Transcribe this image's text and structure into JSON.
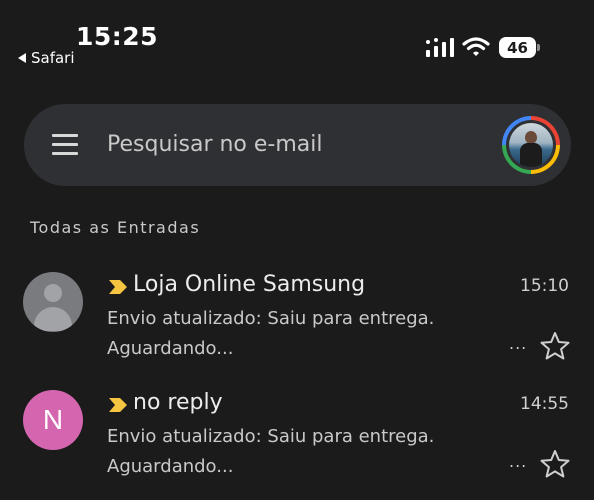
{
  "status_bar": {
    "time": "15:25",
    "back_app": "Safari",
    "battery": "46"
  },
  "search": {
    "placeholder": "Pesquisar no e-mail"
  },
  "section": {
    "title": "Todas as Entradas"
  },
  "emails": [
    {
      "sender": "Loja Online Samsung",
      "time": "15:10",
      "snippet_line1": "Envio atualizado: Saiu para entrega.",
      "snippet_line2": "Aguardando...",
      "more": "...",
      "avatar_letter": ""
    },
    {
      "sender": "no reply",
      "time": "14:55",
      "snippet_line1": "Envio atualizado: Saiu para entrega.",
      "snippet_line2": "Aguardando...",
      "more": "...",
      "avatar_letter": "N"
    }
  ],
  "colors": {
    "background": "#1b1b1c",
    "search_bar": "#2f3033",
    "importance_marker": "#f5c542",
    "avatar_n": "#d466b0"
  },
  "icons": [
    "menu-icon",
    "account-avatar",
    "importance-marker-icon",
    "star-icon",
    "signal-icon",
    "wifi-icon",
    "battery-icon"
  ]
}
